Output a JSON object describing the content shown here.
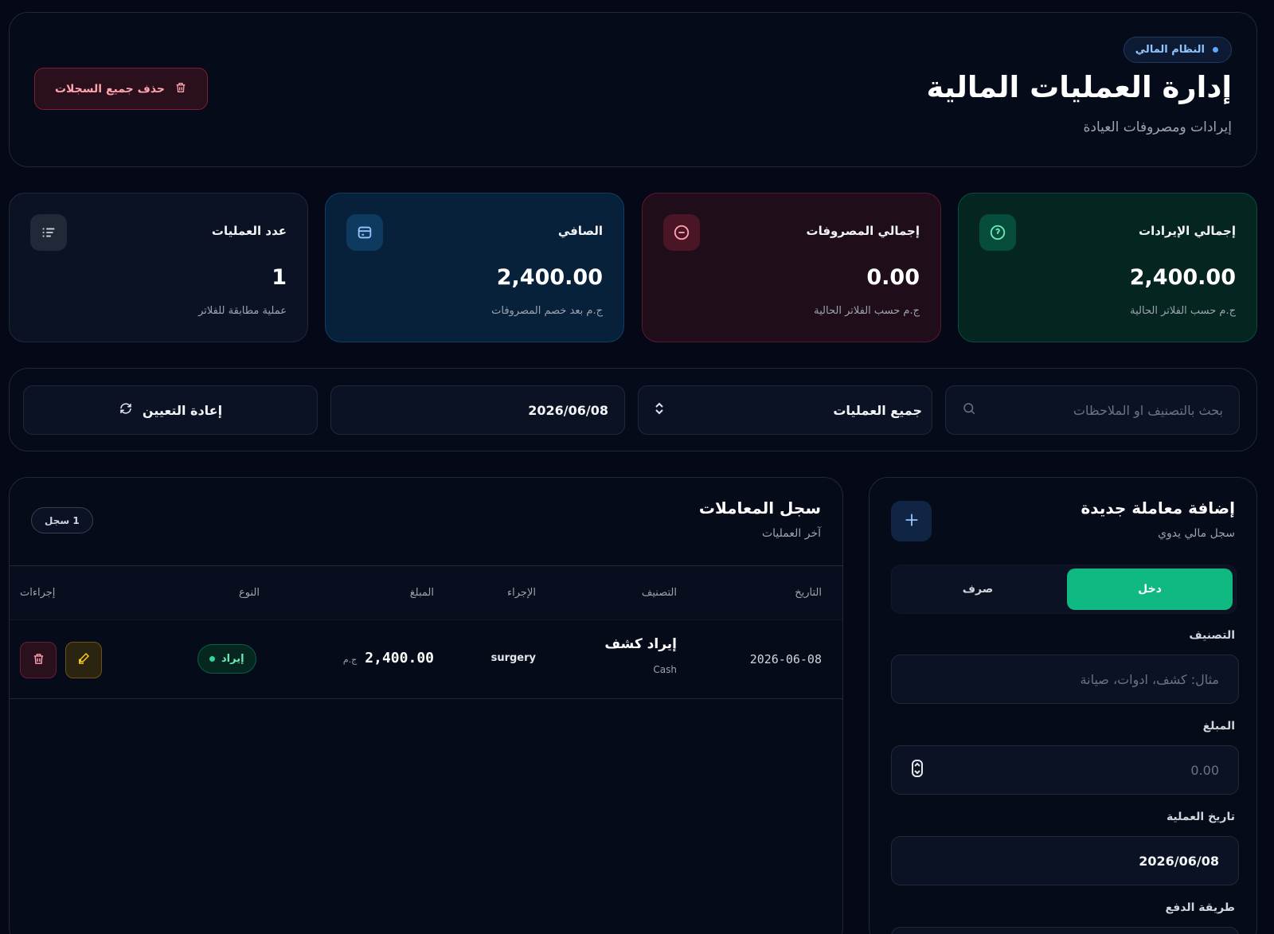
{
  "header": {
    "badge": "النظام المالي",
    "title": "إدارة العمليات المالية",
    "subtitle": "إيرادات ومصروفات العيادة",
    "delete_all": "حذف جميع السجلات"
  },
  "stats": {
    "income": {
      "title": "إجمالي الإيرادات",
      "value": "2,400.00",
      "note": "ج.م حسب الفلاتر الحالية",
      "icon": "coin-icon"
    },
    "expense": {
      "title": "إجمالي المصروفات",
      "value": "0.00",
      "note": "ج.م حسب الفلاتر الحالية",
      "icon": "minus-circle-icon"
    },
    "net": {
      "title": "الصافي",
      "value": "2,400.00",
      "note": "ج.م بعد خصم المصروفات",
      "icon": "wallet-icon"
    },
    "count": {
      "title": "عدد العمليات",
      "value": "1",
      "note": "عملية مطابقة للفلاتر",
      "icon": "list-icon"
    }
  },
  "filters": {
    "search_placeholder": "بحث بالتصنيف او الملاحظات",
    "type_value": "جميع العمليات",
    "date_value": "2026/06/08",
    "reset_label": "إعادة التعيين"
  },
  "addform": {
    "title": "إضافة معاملة جديدة",
    "subtitle": "سجل مالي يدوي",
    "tab_income": "دخل",
    "tab_expense": "صرف",
    "category_label": "التصنيف",
    "category_placeholder": "مثال: كشف، ادوات، صيانة",
    "amount_label": "المبلغ",
    "amount_placeholder": "0.00",
    "date_label": "تاريخ العملية",
    "date_value": "2026/06/08",
    "payment_label": "طريقة الدفع"
  },
  "txlog": {
    "title": "سجل المعاملات",
    "subtitle": "آخر العمليات",
    "count_badge": "1 سجل",
    "columns": {
      "date": "التاريخ",
      "category": "التصنيف",
      "procedure": "الإجراء",
      "amount": "المبلغ",
      "type": "النوع",
      "actions": "إجراءات"
    },
    "rows": [
      {
        "date": "2026-06-08",
        "category": "إيراد كشف",
        "method": "Cash",
        "procedure": "surgery",
        "amount": "2,400.00",
        "currency": "ج.م",
        "type": "إيراد"
      }
    ]
  },
  "colors": {
    "accent_green": "#10b981",
    "danger": "#fda4af",
    "info": "#60a5fa"
  }
}
